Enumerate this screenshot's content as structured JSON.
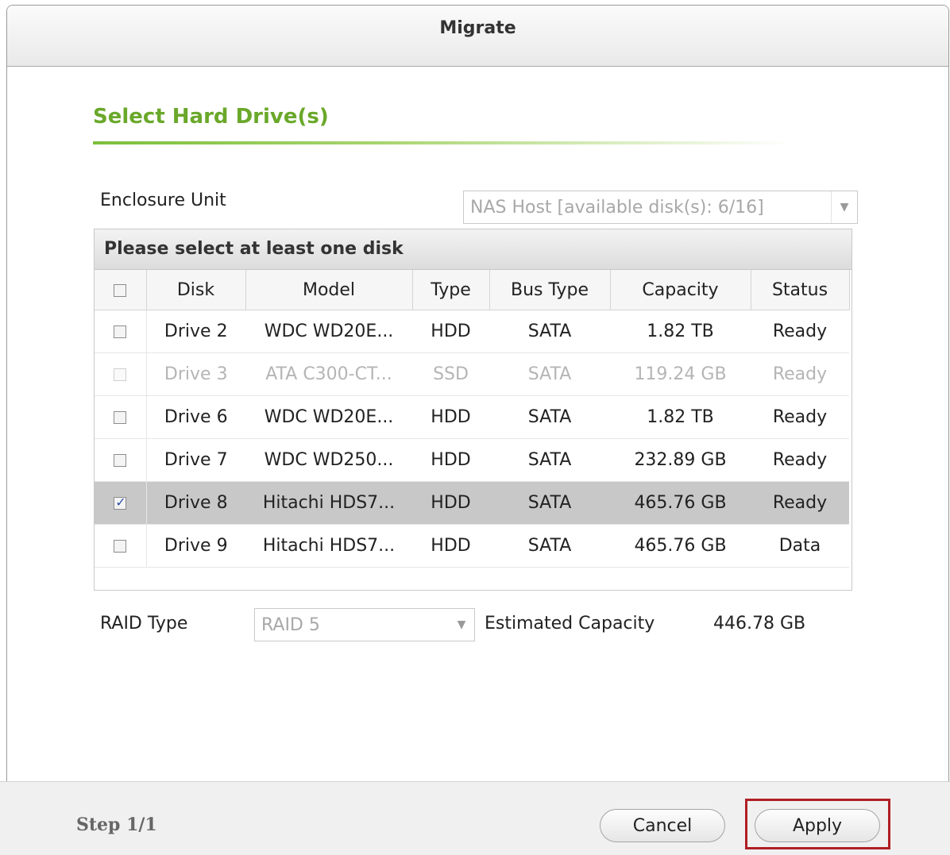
{
  "dialog": {
    "title": "Migrate"
  },
  "section": {
    "title": "Select Hard Drive(s)"
  },
  "enclosure": {
    "label": "Enclosure Unit",
    "value": "NAS Host [available disk(s): 6/16]"
  },
  "grid": {
    "caption": "Please select at least one disk",
    "columns": [
      "Disk",
      "Model",
      "Type",
      "Bus Type",
      "Capacity",
      "Status"
    ],
    "rows": [
      {
        "disk": "Drive 2",
        "model": "WDC WD20E...",
        "type": "HDD",
        "bus": "SATA",
        "capacity": "1.82 TB",
        "status": "Ready"
      },
      {
        "disk": "Drive 3",
        "model": "ATA C300-CT...",
        "type": "SSD",
        "bus": "SATA",
        "capacity": "119.24 GB",
        "status": "Ready"
      },
      {
        "disk": "Drive 6",
        "model": "WDC WD20E...",
        "type": "HDD",
        "bus": "SATA",
        "capacity": "1.82 TB",
        "status": "Ready"
      },
      {
        "disk": "Drive 7",
        "model": "WDC WD250...",
        "type": "HDD",
        "bus": "SATA",
        "capacity": "232.89 GB",
        "status": "Ready"
      },
      {
        "disk": "Drive 8",
        "model": "Hitachi HDS7...",
        "type": "HDD",
        "bus": "SATA",
        "capacity": "465.76 GB",
        "status": "Ready"
      },
      {
        "disk": "Drive 9",
        "model": "Hitachi HDS7...",
        "type": "HDD",
        "bus": "SATA",
        "capacity": "465.76 GB",
        "status": "Data"
      }
    ]
  },
  "raid": {
    "label": "RAID Type",
    "value": "RAID 5"
  },
  "estimate": {
    "label": "Estimated Capacity",
    "value": "446.78 GB"
  },
  "footer": {
    "step": "Step 1/1",
    "cancel_label": "Cancel",
    "apply_label": "Apply"
  },
  "colors": {
    "accent_green": "#6aa82a",
    "highlight_red": "#b01e24",
    "selected_row": "#c8c8c8"
  }
}
